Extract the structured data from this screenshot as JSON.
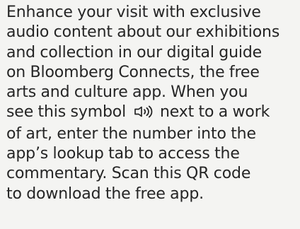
{
  "body_text": {
    "lines": [
      "Enhance your visit with exclusive",
      "audio content about our exhibitions",
      "and collection in our digital guide",
      "on Bloomberg Connects, the free",
      "arts and culture app. When you",
      "see this symbol",
      "next to a work",
      "of art, enter the number into the",
      "app’s lookup tab to access the",
      "commentary. Scan this QR code",
      "to download the free app."
    ]
  },
  "icons": {
    "audio_symbol": "speaker-sound-icon"
  },
  "colors": {
    "background": "#f4f4f2",
    "text": "#252525"
  }
}
